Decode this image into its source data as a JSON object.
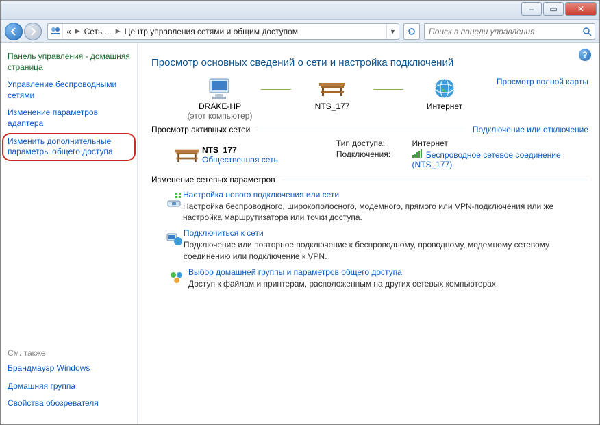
{
  "window": {
    "minimize": "–",
    "maximize": "▭",
    "close": "✕"
  },
  "address": {
    "root_hint": "«",
    "crumb1": "Сеть ...",
    "crumb2": "Центр управления сетями и общим доступом"
  },
  "search": {
    "placeholder": "Поиск в панели управления"
  },
  "sidebar": {
    "home_title": "Панель управления - домашняя страница",
    "links": [
      "Управление беспроводными сетями",
      "Изменение параметров адаптера",
      "Изменить дополнительные параметры общего доступа"
    ],
    "see_also": "См. также",
    "see_links": [
      "Брандмауэр Windows",
      "Домашняя группа",
      "Свойства обозревателя"
    ]
  },
  "main": {
    "heading": "Просмотр основных сведений о сети и настройка подключений",
    "map": {
      "pc_name": "DRAKE-HP",
      "pc_sub": "(этот компьютер)",
      "net_name": "NTS_177",
      "internet": "Интернет",
      "full_map": "Просмотр полной карты"
    },
    "active_head": "Просмотр активных сетей",
    "active_link": "Подключение или отключение",
    "active": {
      "name": "NTS_177",
      "kind": "Общественная сеть",
      "type_label": "Тип доступа:",
      "type_value": "Интернет",
      "conn_label": "Подключения:",
      "conn_value": "Беспроводное сетевое соединение (NTS_177)"
    },
    "settings_head": "Изменение сетевых параметров",
    "tasks": [
      {
        "title": "Настройка нового подключения или сети",
        "desc": "Настройка беспроводного, широкополосного, модемного, прямого или VPN-подключения или же настройка маршрутизатора или точки доступа."
      },
      {
        "title": "Подключиться к сети",
        "desc": "Подключение или повторное подключение к беспроводному, проводному, модемному сетевому соединению или подключение к VPN."
      },
      {
        "title": "Выбор домашней группы и параметров общего доступа",
        "desc": "Доступ к файлам и принтерам, расположенным на других сетевых компьютерах,"
      }
    ]
  }
}
